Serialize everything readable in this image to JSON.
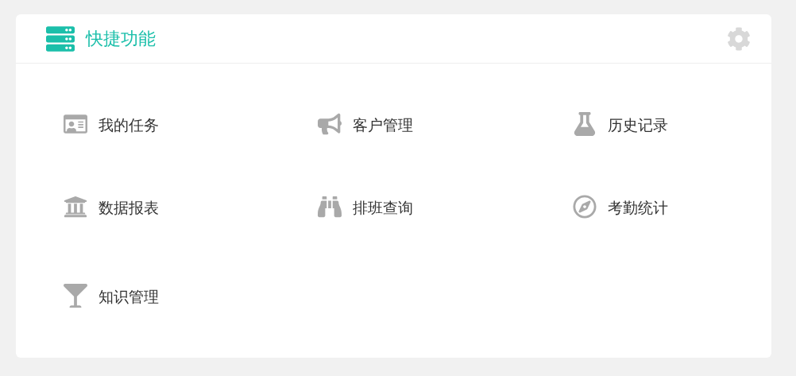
{
  "panel": {
    "title": "快捷功能"
  },
  "items": [
    {
      "label": "我的任务"
    },
    {
      "label": "客户管理"
    },
    {
      "label": "历史记录"
    },
    {
      "label": "数据报表"
    },
    {
      "label": "排班查询"
    },
    {
      "label": "考勤统计"
    },
    {
      "label": "知识管理"
    }
  ]
}
